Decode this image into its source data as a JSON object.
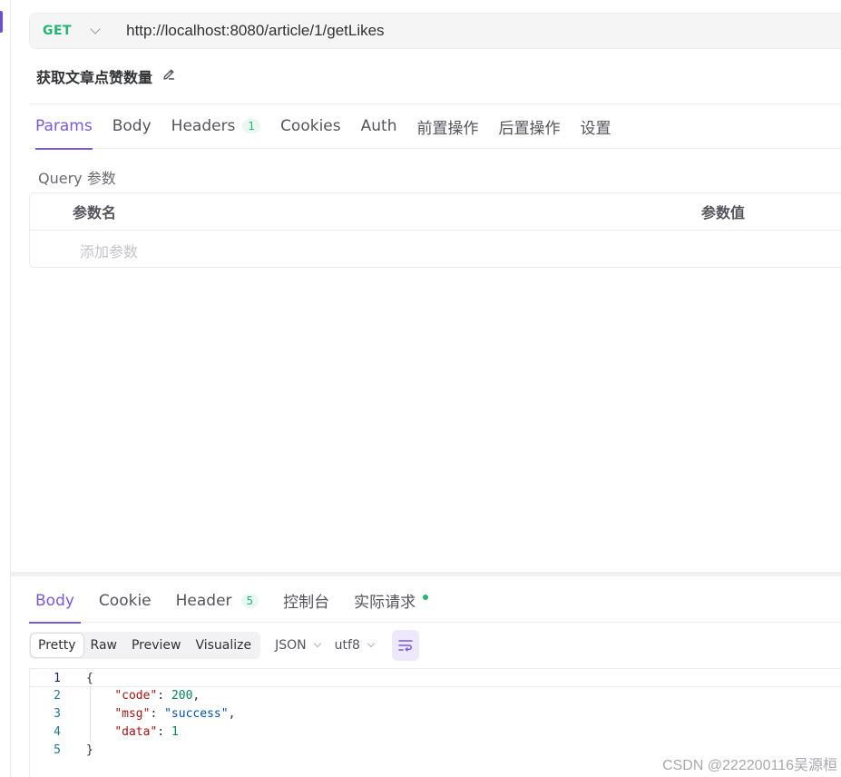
{
  "request": {
    "method": "GET",
    "url": "http://localhost:8080/article/1/getLikes",
    "name": "获取文章点赞数量"
  },
  "request_tabs": [
    {
      "label": "Params"
    },
    {
      "label": "Body"
    },
    {
      "label": "Headers",
      "badge": "1"
    },
    {
      "label": "Cookies"
    },
    {
      "label": "Auth"
    },
    {
      "label": "前置操作"
    },
    {
      "label": "后置操作"
    },
    {
      "label": "设置"
    }
  ],
  "params": {
    "section_label": "Query 参数",
    "col_name": "参数名",
    "col_value": "参数值",
    "add_placeholder": "添加参数"
  },
  "response_tabs": [
    {
      "label": "Body"
    },
    {
      "label": "Cookie"
    },
    {
      "label": "Header",
      "badge": "5"
    },
    {
      "label": "控制台"
    },
    {
      "label": "实际请求"
    }
  ],
  "view_modes": [
    "Pretty",
    "Raw",
    "Preview",
    "Visualize"
  ],
  "format": "JSON",
  "encoding": "utf8",
  "code": {
    "line_numbers": [
      "1",
      "2",
      "3",
      "4",
      "5"
    ],
    "open_brace": "{",
    "close_brace": "}",
    "key_code": "\"code\"",
    "val_code": "200",
    "key_msg": "\"msg\"",
    "val_msg": "\"success\"",
    "key_data": "\"data\"",
    "val_data": "1"
  },
  "watermark": "CSDN @222200116吴源桓",
  "colors": {
    "accent": "#7a5ad8",
    "method_get": "#22b573"
  }
}
